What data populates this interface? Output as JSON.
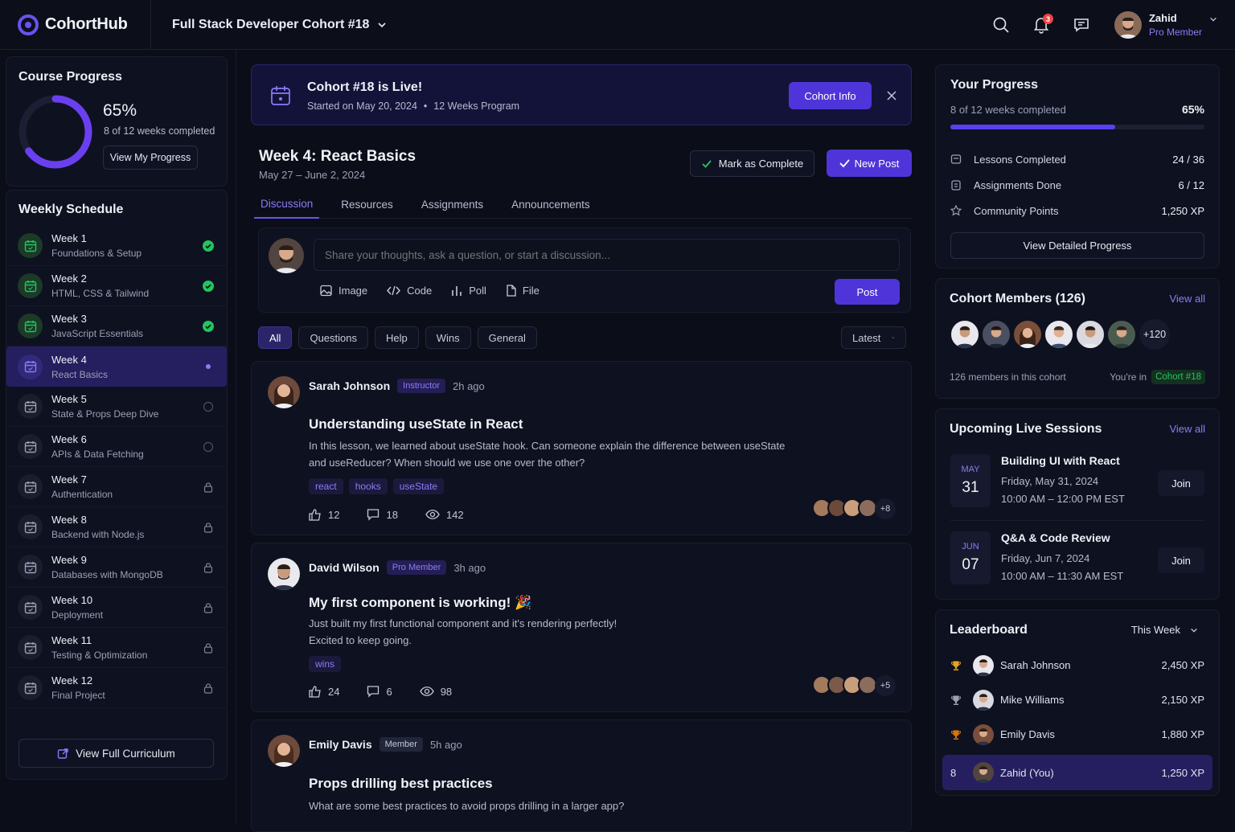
{
  "brand": {
    "name": "CohortHub"
  },
  "header": {
    "cohort_title": "Full Stack Developer Cohort #18",
    "notification_count": "3",
    "user_name": "Zahid",
    "user_role": "Pro Member"
  },
  "course_progress": {
    "title": "Course Progress",
    "percent_label": "65%",
    "percent": 65,
    "weeks_label": "8 of 12 weeks completed",
    "button": "View My Progress"
  },
  "schedule": {
    "title": "Weekly Schedule",
    "weeks": [
      {
        "title": "Week 1",
        "sub": "Foundations & Setup",
        "status": "done"
      },
      {
        "title": "Week 2",
        "sub": "HTML, CSS & Tailwind",
        "status": "done"
      },
      {
        "title": "Week 3",
        "sub": "JavaScript Essentials",
        "status": "done"
      },
      {
        "title": "Week 4",
        "sub": "React Basics",
        "status": "active"
      },
      {
        "title": "Week 5",
        "sub": "State & Props Deep Dive",
        "status": "open"
      },
      {
        "title": "Week 6",
        "sub": "APIs & Data Fetching",
        "status": "open"
      },
      {
        "title": "Week 7",
        "sub": "Authentication",
        "status": "locked"
      },
      {
        "title": "Week 8",
        "sub": "Backend with Node.js",
        "status": "locked"
      },
      {
        "title": "Week 9",
        "sub": "Databases with MongoDB",
        "status": "locked"
      },
      {
        "title": "Week 10",
        "sub": "Deployment",
        "status": "locked"
      },
      {
        "title": "Week 11",
        "sub": "Testing & Optimization",
        "status": "locked"
      },
      {
        "title": "Week 12",
        "sub": "Final Project",
        "status": "locked"
      }
    ],
    "curriculum_button": "View Full Curriculum"
  },
  "banner": {
    "title": "Cohort #18 is Live!",
    "started": "Started on May 20, 2024",
    "program": "12 Weeks Program",
    "button": "Cohort Info"
  },
  "week": {
    "title": "Week 4: React Basics",
    "dates": "May 27 – June 2, 2024",
    "complete_button": "Mark as Complete",
    "new_post_button": "New Post"
  },
  "tabs": [
    "Discussion",
    "Resources",
    "Assignments",
    "Announcements"
  ],
  "composer": {
    "placeholder": "Share your thoughts, ask a question, or start a discussion...",
    "actions": [
      "Image",
      "Code",
      "Poll",
      "File"
    ],
    "post_button": "Post"
  },
  "filters": {
    "chips": [
      "All",
      "Questions",
      "Help",
      "Wins",
      "General"
    ],
    "sort": "Latest"
  },
  "posts": [
    {
      "author": "Sarah Johnson",
      "role": "Instructor",
      "time": "2h ago",
      "title": "Understanding useState in React",
      "body_1": "In this lesson, we learned about useState hook. Can someone explain the difference between useState",
      "body_2": "and useReducer? When should we use one over the other?",
      "tags": [
        "react",
        "hooks",
        "useState"
      ],
      "likes": "12",
      "comments": "18",
      "views": "142",
      "more": "+8"
    },
    {
      "author": "David Wilson",
      "role": "Pro Member",
      "time": "3h ago",
      "title": "My first component is working! 🎉",
      "body_1": "Just built my first functional component and it's rendering perfectly!",
      "body_2": "Excited to keep going.",
      "tags": [
        "wins"
      ],
      "likes": "24",
      "comments": "6",
      "views": "98",
      "more": "+5"
    },
    {
      "author": "Emily Davis",
      "role": "Member",
      "time": "5h ago",
      "title": "Props drilling best practices",
      "body_1": "What are some best practices to avoid props drilling in a larger app?"
    }
  ],
  "your_progress": {
    "title": "Your Progress",
    "weeks_label": "8 of 12 weeks completed",
    "percent_label": "65%",
    "percent": 65,
    "rows": [
      {
        "label": "Lessons Completed",
        "value": "24 / 36"
      },
      {
        "label": "Assignments Done",
        "value": "6 / 12"
      },
      {
        "label": "Community Points",
        "value": "1,250 XP"
      }
    ],
    "button": "View Detailed Progress"
  },
  "members": {
    "title": "Cohort Members (126)",
    "view_all": "View all",
    "more": "+120",
    "count_label": "126 members in this cohort",
    "youre_in": "You're in",
    "cohort_tag": "Cohort #18"
  },
  "sessions": {
    "title": "Upcoming Live Sessions",
    "view_all": "View all",
    "items": [
      {
        "month": "MAY",
        "day": "31",
        "title": "Building UI with React",
        "date": "Friday, May 31, 2024",
        "time": "10:00 AM – 12:00 PM EST",
        "button": "Join"
      },
      {
        "month": "JUN",
        "day": "07",
        "title": "Q&A & Code Review",
        "date": "Friday, Jun 7, 2024",
        "time": "10:00 AM – 11:30 AM EST",
        "button": "Join"
      }
    ]
  },
  "leaderboard": {
    "title": "Leaderboard",
    "period": "This Week",
    "rows": [
      {
        "rank": "",
        "medal": "#e5a524",
        "name": "Sarah Johnson",
        "xp": "2,450 XP"
      },
      {
        "rank": "",
        "medal": "#9ca3af",
        "name": "Mike Williams",
        "xp": "2,150 XP"
      },
      {
        "rank": "",
        "medal": "#d97706",
        "name": "Emily Davis",
        "xp": "1,880 XP"
      },
      {
        "rank": "8",
        "medal": "",
        "name": "Zahid (You)",
        "xp": "1,250 XP"
      }
    ]
  },
  "colors": {
    "accent": "#4f35d9",
    "accent_light": "#8b7cf6",
    "success": "#22c55e",
    "bg": "#0b0d18"
  }
}
